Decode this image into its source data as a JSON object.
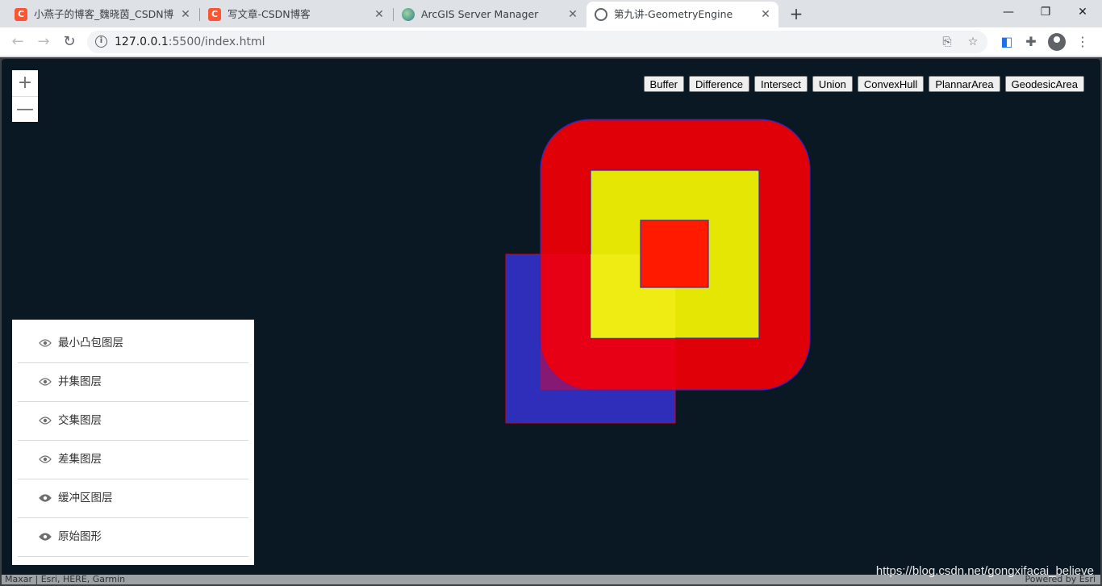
{
  "browser": {
    "tabs": [
      {
        "title": "小燕子的博客_魏晓茵_CSDN博客",
        "favicon": "csdn-icon"
      },
      {
        "title": "写文章-CSDN博客",
        "favicon": "csdn-icon"
      },
      {
        "title": "ArcGIS Server Manager",
        "favicon": "arcgis-icon"
      },
      {
        "title": "第九讲-GeometryEngine",
        "favicon": "globe-icon",
        "active": true
      }
    ],
    "url_host": "127.0.0.1",
    "url_path": ":5500/index.html"
  },
  "map": {
    "zoom_in": "+",
    "zoom_out": "—",
    "buttons": [
      "Buffer",
      "Difference",
      "Intersect",
      "Union",
      "ConvexHull",
      "PlannarArea",
      "GeodesicArea"
    ],
    "layers": [
      "最小凸包图层",
      "并集图层",
      "交集图层",
      "差集图层",
      "缓冲区图层",
      "原始图形"
    ],
    "attribution_left": "Maxar | Esri, HERE, Garmin",
    "attribution_right": "Powered by Esri",
    "watermark": "https://blog.csdn.net/gongxifacai_believe",
    "colors": {
      "background": "#0a1823",
      "buffer_fill": "#e60008",
      "buffer_stroke": "#2020c0",
      "yellow_fill": "#e6e604",
      "blue_fill": "#2e2eba",
      "inner_red": "#ff1a00"
    }
  }
}
